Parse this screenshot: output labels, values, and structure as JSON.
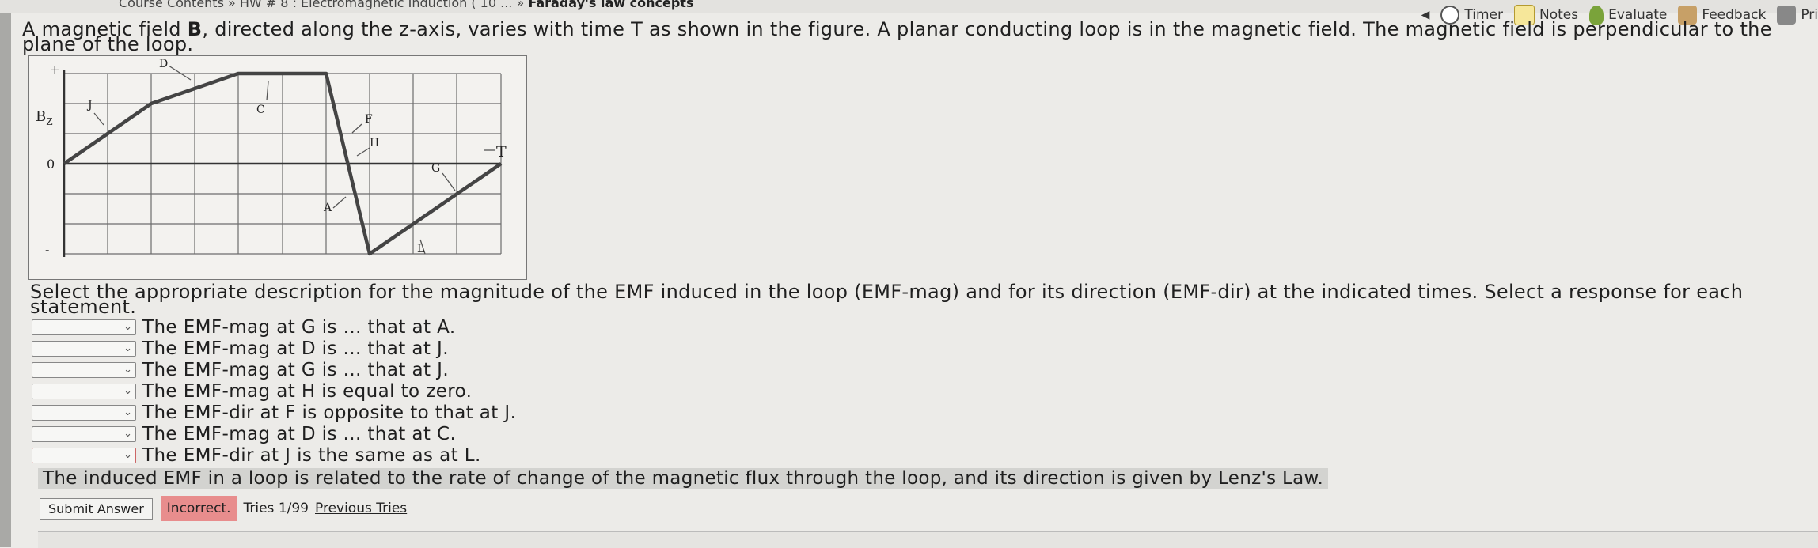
{
  "breadcrumb": {
    "prefix": "Course Contents » HW # 8 : Electromagnetic Induction ( 10 ... »",
    "current": "Faraday's law concepts"
  },
  "toolbar": {
    "back_icon": "triangle-left-icon",
    "timer": "Timer",
    "notes": "Notes",
    "evaluate": "Evaluate",
    "feedback": "Feedback",
    "print": "Pri"
  },
  "problem": {
    "prefix": "A magnetic field ",
    "bold": "B",
    "rest": ", directed along the z-axis, varies with time T as shown in the figure. A planar conducting loop is in the magnetic field. The magnetic field is perpendicular to the plane of the loop."
  },
  "figure": {
    "y_label": "B",
    "y_sub": "Z",
    "plus": "+",
    "zero": "0",
    "minus": "-",
    "x_label": "T",
    "points": [
      "J",
      "D",
      "C",
      "F",
      "H",
      "A",
      "G",
      "L"
    ]
  },
  "question": "Select the appropriate description for the magnitude of the EMF induced in the loop (EMF-mag) and for its direction (EMF-dir) at the indicated times. Select a response for each statement.",
  "statements": [
    "The EMF-mag at G is ... that at A.",
    "The EMF-mag at D is ... that at J.",
    "The EMF-mag at G is ... that at J.",
    "The EMF-mag at H is equal to zero.",
    "The EMF-dir at F is opposite to that at J.",
    "The EMF-mag at D is ... that at C.",
    "The EMF-dir at J is the same as at L."
  ],
  "select_value": "",
  "hint": "The induced EMF in a loop is related to the rate of change of the magnetic flux through the loop, and its direction is given by Lenz's Law.",
  "actions": {
    "submit": "Submit Answer",
    "status": "Incorrect.",
    "tries": "Tries 1/99",
    "previous": "Previous Tries"
  },
  "colors": {
    "incorrect": "#e88d8d",
    "background": "#ecebe8"
  }
}
